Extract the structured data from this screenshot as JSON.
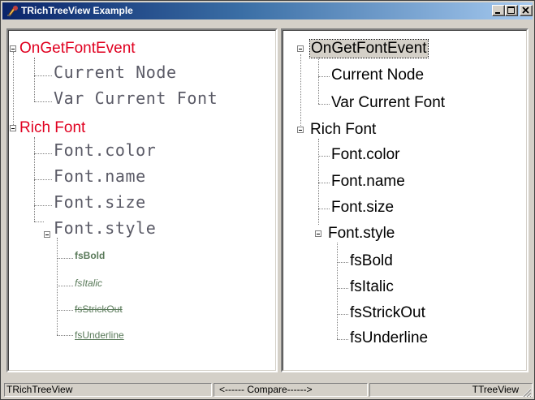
{
  "window": {
    "title": "TRichTreeView  Example"
  },
  "left_tree": {
    "root1": {
      "label": "OnGetFontEvent",
      "children": [
        "Current Node",
        "Var Current Font"
      ]
    },
    "root2": {
      "label": "Rich Font",
      "children": [
        "Font.color",
        "Font.name",
        "Font.size"
      ],
      "style_node": {
        "label": "Font.style",
        "children": [
          "fsBold",
          "fsItalic",
          "fsStrickOut",
          "fsUnderline"
        ]
      }
    }
  },
  "right_tree": {
    "root1": {
      "label": "OnGetFontEvent",
      "children": [
        "Current Node",
        "Var Current Font"
      ]
    },
    "root2": {
      "label": "Rich Font",
      "children": [
        "Font.color",
        "Font.name",
        "Font.size"
      ],
      "style_node": {
        "label": "Font.style",
        "children": [
          "fsBold",
          "fsItalic",
          "fsStrickOut",
          "fsUnderline"
        ]
      }
    }
  },
  "statusbar": {
    "left": "TRichTreeView",
    "center": "<------ Compare------>",
    "right": "TTreeView"
  },
  "colors": {
    "left_root": "#e00020",
    "left_mono": "#5a5a66",
    "left_small": "#5a7a5a",
    "title_start": "#0a246a",
    "title_end": "#a6caf0"
  },
  "icons": [
    "app-icon",
    "minimize-icon",
    "maximize-icon",
    "close-icon",
    "expander-minus-icon",
    "size-grip-icon"
  ]
}
